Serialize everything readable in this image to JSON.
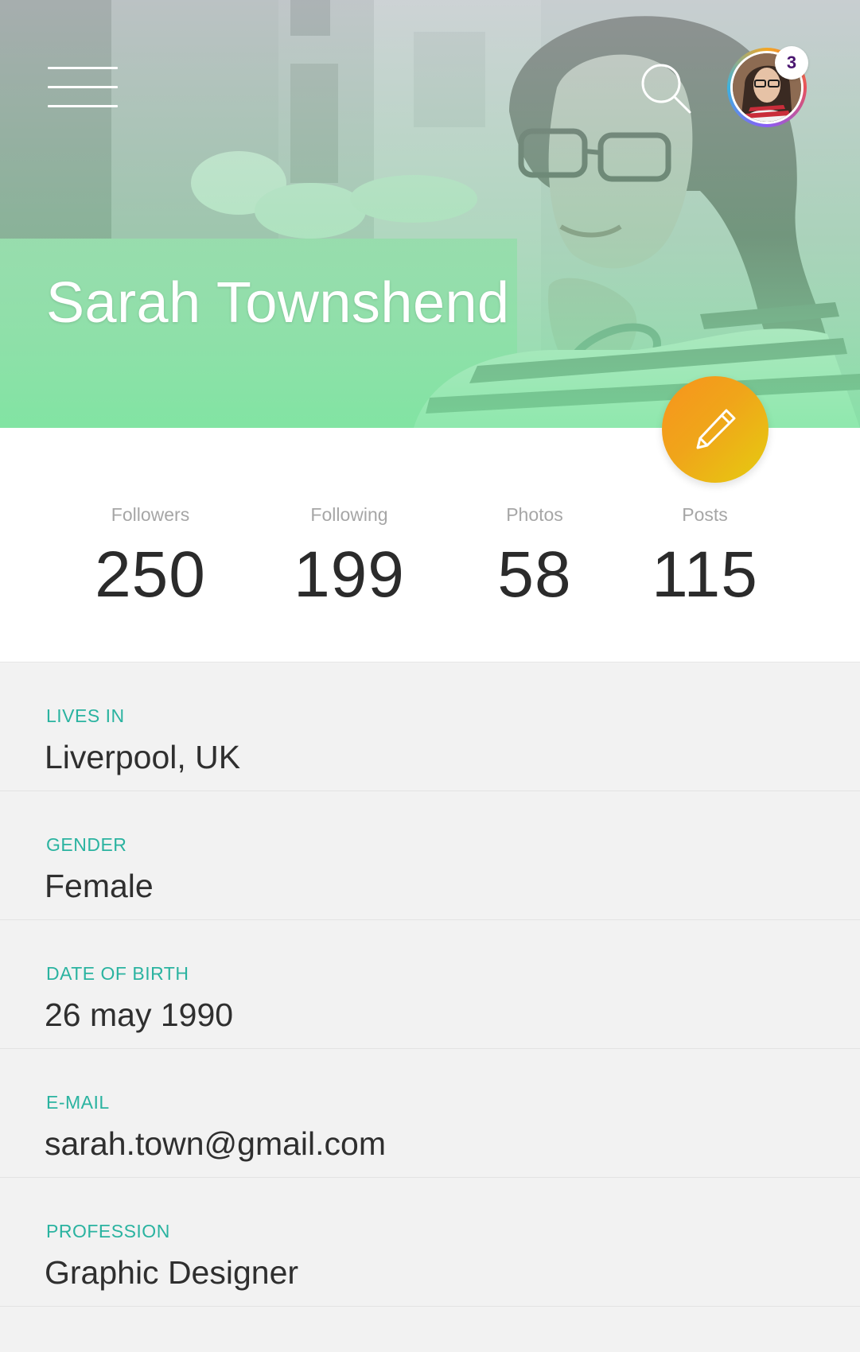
{
  "profile": {
    "name": "Sarah Townshend",
    "notification_count": "3"
  },
  "header": {
    "menu_icon": "hamburger-menu-icon",
    "search_icon": "search-icon",
    "edit_icon": "pencil-icon"
  },
  "colors": {
    "accent": "#2ab3a0",
    "fab_start": "#f7941d",
    "fab_end": "#e5cc10",
    "hero_tint": "#7fe0a0",
    "badge_text": "#4a1670"
  },
  "stats": [
    {
      "label": "Followers",
      "value": "250"
    },
    {
      "label": "Following",
      "value": "199"
    },
    {
      "label": "Photos",
      "value": "58"
    },
    {
      "label": "Posts",
      "value": "115"
    }
  ],
  "details": [
    {
      "label": "LIVES IN",
      "value": "Liverpool, UK"
    },
    {
      "label": "GENDER",
      "value": "Female"
    },
    {
      "label": "DATE OF BIRTH",
      "value": "26 may 1990"
    },
    {
      "label": "E-MAIL",
      "value": "sarah.town@gmail.com"
    },
    {
      "label": "PROFESSION",
      "value": "Graphic Designer"
    }
  ]
}
